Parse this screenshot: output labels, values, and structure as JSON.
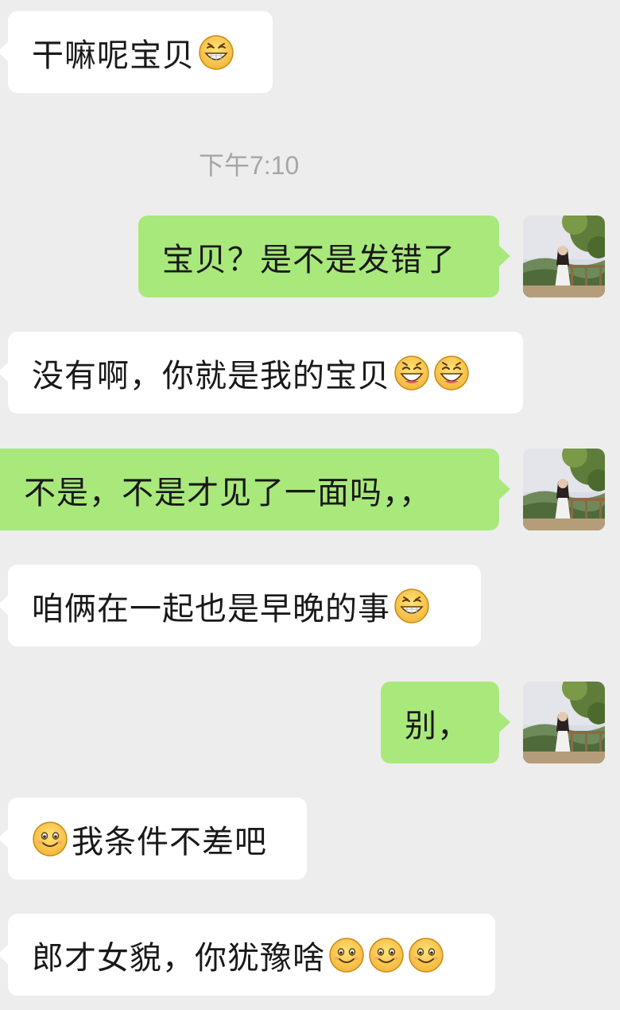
{
  "timestamp": "下午7:10",
  "messages": [
    {
      "side": "in",
      "text": "干嘛呢宝贝",
      "emojis": [
        "grin-emoji"
      ]
    },
    {
      "side": "out",
      "text": "宝贝？是不是发错了"
    },
    {
      "side": "in",
      "text": "没有啊，你就是我的宝贝",
      "emojis": [
        "laugh-emoji",
        "laugh-emoji"
      ]
    },
    {
      "side": "out",
      "text": "不是，不是才见了一面吗，，"
    },
    {
      "side": "in",
      "text": "咱俩在一起也是早晚的事",
      "emojis": [
        "grin-emoji"
      ]
    },
    {
      "side": "out",
      "text": "别，"
    },
    {
      "side": "in",
      "text": "我条件不差吧",
      "lead_emoji": "smile-emoji"
    },
    {
      "side": "in",
      "text": "郎才女貌，你犹豫啥",
      "emojis": [
        "smile-emoji",
        "smile-emoji",
        "smile-emoji"
      ]
    }
  ],
  "colors": {
    "background": "#ededed",
    "incoming_bubble": "#ffffff",
    "outgoing_bubble": "#a9e97c",
    "timestamp": "#a6a6a6"
  }
}
